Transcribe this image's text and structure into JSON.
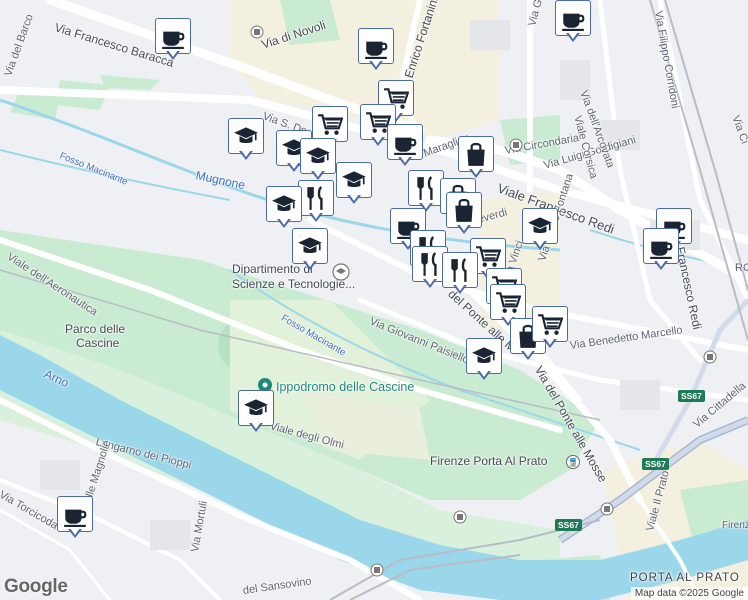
{
  "map": {
    "attribution": "Map data ©2025 Google",
    "google_logo": "Google",
    "colors": {
      "water": "#9bd7ea",
      "park": "#c9ebd1",
      "road": "#ffffff",
      "marker_border": "#4a6aa8",
      "marker_icon": "#1a2433"
    }
  },
  "labels": [
    {
      "id": "via-del-barco",
      "text": "Via del Barco"
    },
    {
      "id": "via-baracca",
      "text": "Via Francesco Baracca"
    },
    {
      "id": "via-di-novoli",
      "text": "Via di Novoli"
    },
    {
      "id": "via-fortanini",
      "text": "Via Enrico Fortanini"
    },
    {
      "id": "via-s-do",
      "text": "Via S. Do"
    },
    {
      "id": "fosso-macinante-1",
      "text": "Fosso Macinante"
    },
    {
      "id": "mugnone",
      "text": "Mugnone"
    },
    {
      "id": "maragliano",
      "text": "Maraglian"
    },
    {
      "id": "via-circondaria",
      "text": "Via Circondaria"
    },
    {
      "id": "via-gordigiani",
      "text": "Via Luigi Gordigiani"
    },
    {
      "id": "viale-redi",
      "text": "Viale Francesco Redi"
    },
    {
      "id": "via-arcovata",
      "text": "Via dell'Arcovata"
    },
    {
      "id": "viale-corsica",
      "text": "Viale Corsica"
    },
    {
      "id": "via-corridoni",
      "text": "Via Filippo Corridoni"
    },
    {
      "id": "via-ga",
      "text": "Via Ga"
    },
    {
      "id": "viale-aeronautica",
      "text": "Viale dell'Aeronautica"
    },
    {
      "id": "dipartimento",
      "text": "Dipartimento di"
    },
    {
      "id": "scienze",
      "text": "Scienze e Tecnologie..."
    },
    {
      "id": "parco-cascine",
      "text": "Parco delle"
    },
    {
      "id": "parco-cascine-2",
      "text": "Cascine"
    },
    {
      "id": "fosso-macinante-2",
      "text": "Fosso Macinante"
    },
    {
      "id": "arno",
      "text": "Arno"
    },
    {
      "id": "ippodromo",
      "text": "Ippodromo delle Cascine"
    },
    {
      "id": "viale-olmi",
      "text": "Viale degli Olmi"
    },
    {
      "id": "via-paisiello",
      "text": "Via Giovanni Paisiello"
    },
    {
      "id": "via-marcello",
      "text": "Via Benedetto Marcello"
    },
    {
      "id": "via-ponte-mosse",
      "text": "Via del Ponte alle Mosse"
    },
    {
      "id": "via-ponte-mosse-2",
      "text": "del Ponte alle M"
    },
    {
      "id": "verdi",
      "text": "everdi"
    },
    {
      "id": "via-vinci",
      "text": "Via Vinci"
    },
    {
      "id": "via-felice-fontana",
      "text": "Via Felice Fontana"
    },
    {
      "id": "francesco-redi",
      "text": "Francesco Redi"
    },
    {
      "id": "ro",
      "text": "RO"
    },
    {
      "id": "via-cittadella",
      "text": "Via Cittadella"
    },
    {
      "id": "ss67-1",
      "text": "SS67"
    },
    {
      "id": "ss67-2",
      "text": "SS67"
    },
    {
      "id": "ss67-3",
      "text": "SS67"
    },
    {
      "id": "firenze-porta",
      "text": "Firenze Porta Al Prato"
    },
    {
      "id": "lungarno-pioppi",
      "text": "Lungarno dei Pioppi"
    },
    {
      "id": "via-torcicoda",
      "text": "Via Torcicoda"
    },
    {
      "id": "via-magnolie",
      "text": "Via delle Magnolie"
    },
    {
      "id": "via-mortuli",
      "text": "Via Mortuli"
    },
    {
      "id": "via-sansovino",
      "text": "del Sansovino"
    },
    {
      "id": "porta-al-prato",
      "text": "PORTA AL PRATO"
    },
    {
      "id": "viale-il-prato",
      "text": "Viale Il Prato"
    },
    {
      "id": "firenze-ma",
      "text": "Firenze Ma"
    },
    {
      "id": "via-ci",
      "text": "Via Ci"
    }
  ],
  "markers": [
    {
      "type": "cafe"
    },
    {
      "type": "cafe"
    },
    {
      "type": "cafe"
    },
    {
      "type": "shopping-cart"
    },
    {
      "type": "shopping-cart"
    },
    {
      "type": "shopping-cart"
    },
    {
      "type": "school"
    },
    {
      "type": "school"
    },
    {
      "type": "school"
    },
    {
      "type": "cafe"
    },
    {
      "type": "shopping-bag"
    },
    {
      "type": "school"
    },
    {
      "type": "restaurant"
    },
    {
      "type": "restaurant"
    },
    {
      "type": "school"
    },
    {
      "type": "shopping-bag"
    },
    {
      "type": "shopping-bag"
    },
    {
      "type": "cafe"
    },
    {
      "type": "restaurant"
    },
    {
      "type": "school"
    },
    {
      "type": "restaurant"
    },
    {
      "type": "shopping-cart"
    },
    {
      "type": "restaurant"
    },
    {
      "type": "shopping-cart"
    },
    {
      "type": "shopping-cart"
    },
    {
      "type": "shopping-bag"
    },
    {
      "type": "shopping-cart"
    },
    {
      "type": "school"
    },
    {
      "type": "school"
    },
    {
      "type": "cafe"
    },
    {
      "type": "cafe"
    },
    {
      "type": "cafe"
    },
    {
      "type": "school"
    }
  ]
}
